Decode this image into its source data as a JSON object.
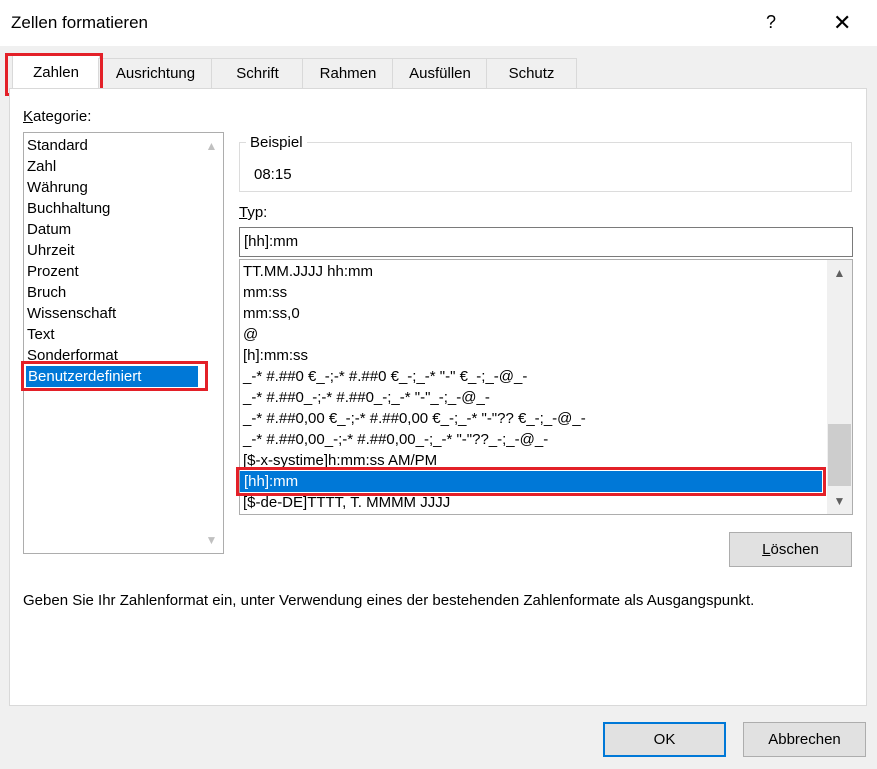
{
  "dialog": {
    "title": "Zellen formatieren",
    "help_label": "?",
    "close_label": "✕"
  },
  "tabs": [
    {
      "label": "Zahlen"
    },
    {
      "label": "Ausrichtung"
    },
    {
      "label": "Schrift"
    },
    {
      "label": "Rahmen"
    },
    {
      "label": "Ausfüllen"
    },
    {
      "label": "Schutz"
    }
  ],
  "kategorie": {
    "label_first": "K",
    "label_rest": "ategorie:",
    "items": [
      "Standard",
      "Zahl",
      "Währung",
      "Buchhaltung",
      "Datum",
      "Uhrzeit",
      "Prozent",
      "Bruch",
      "Wissenschaft",
      "Text",
      "Sonderformat",
      "Benutzerdefiniert"
    ],
    "selected": "Benutzerdefiniert"
  },
  "beispiel": {
    "label": "Beispiel",
    "value": "08:15"
  },
  "typ": {
    "label_first": "T",
    "label_rest": "yp:",
    "value": "[hh]:mm",
    "list": [
      "TT.MM.JJJJ hh:mm",
      "mm:ss",
      "mm:ss,0",
      "@",
      "[h]:mm:ss",
      "_-* #.##0 €_-;-* #.##0 €_-;_-* \"-\" €_-;_-@_-",
      "_-* #.##0_-;-* #.##0_-;_-* \"-\"_-;_-@_-",
      "_-* #.##0,00 €_-;-* #.##0,00 €_-;_-* \"-\"?? €_-;_-@_-",
      "_-* #.##0,00_-;-* #.##0,00_-;_-* \"-\"??_-;_-@_-",
      "[$-x-systime]h:mm:ss AM/PM",
      "[hh]:mm",
      "[$-de-DE]TTTT, T. MMMM JJJJ"
    ],
    "selected": "[hh]:mm"
  },
  "loeschen": {
    "label_first": "L",
    "label_rest": "öschen"
  },
  "hint": "Geben Sie Ihr Zahlenformat ein, unter Verwendung eines der bestehenden Zahlenformate als Ausgangspunkt.",
  "footer": {
    "ok_label": "OK",
    "cancel_label": "Abbrechen"
  },
  "icons": {
    "scroll_up": "chevron-up-icon",
    "scroll_down": "chevron-down-icon"
  },
  "colors": {
    "selection": "#0078d7",
    "highlight": "#e32028",
    "ok_border": "#0078d7"
  }
}
